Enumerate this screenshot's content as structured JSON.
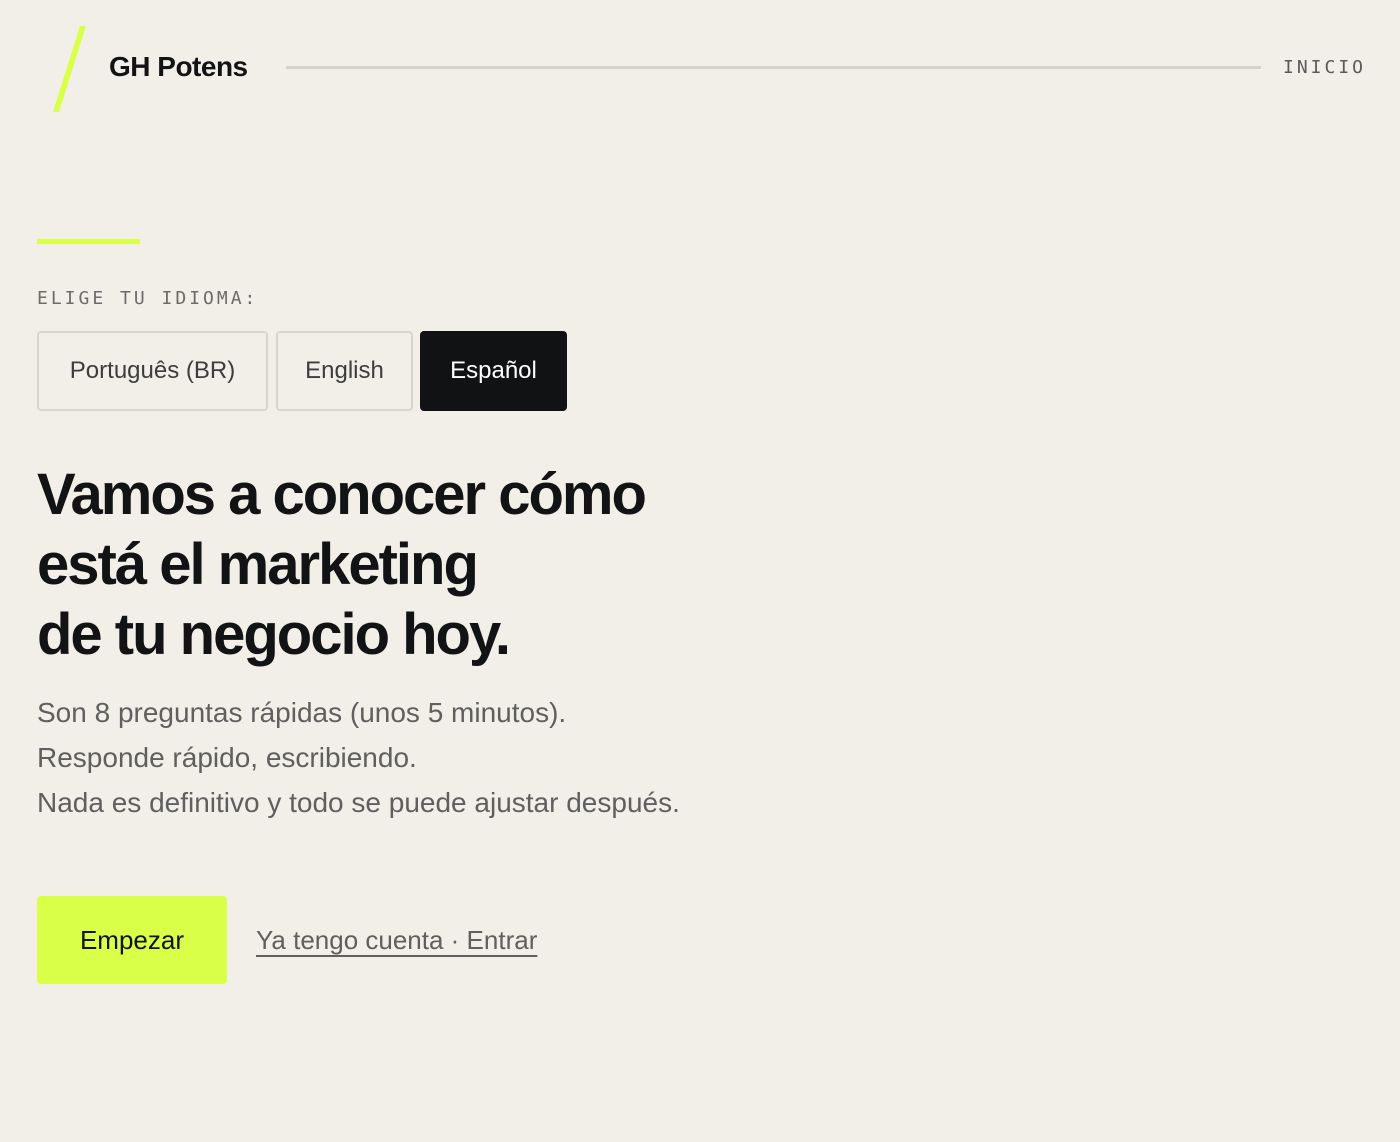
{
  "header": {
    "brand_name": "GH Potens",
    "nav_home": "INICIO"
  },
  "language": {
    "label": "ELIGE TU IDIOMA:",
    "options": [
      {
        "label": "Português (BR)",
        "selected": false
      },
      {
        "label": "English",
        "selected": false
      },
      {
        "label": "Español",
        "selected": true
      }
    ]
  },
  "hero": {
    "headline": [
      "Vamos a conocer cómo",
      "está el marketing",
      "de tu negocio hoy."
    ],
    "description": [
      "Son 8 preguntas rápidas (unos 5 minutos).",
      "Responde rápido, escribiendo.",
      "Nada es definitivo y todo se puede ajustar después."
    ]
  },
  "actions": {
    "start_label": "Empezar",
    "login_label": "Ya tengo cuenta · Entrar"
  },
  "colors": {
    "background": "#f2efe8",
    "accent": "#d9ff48",
    "dark": "#101214"
  },
  "icons": {
    "brand_mark": "slash-logo-icon"
  }
}
